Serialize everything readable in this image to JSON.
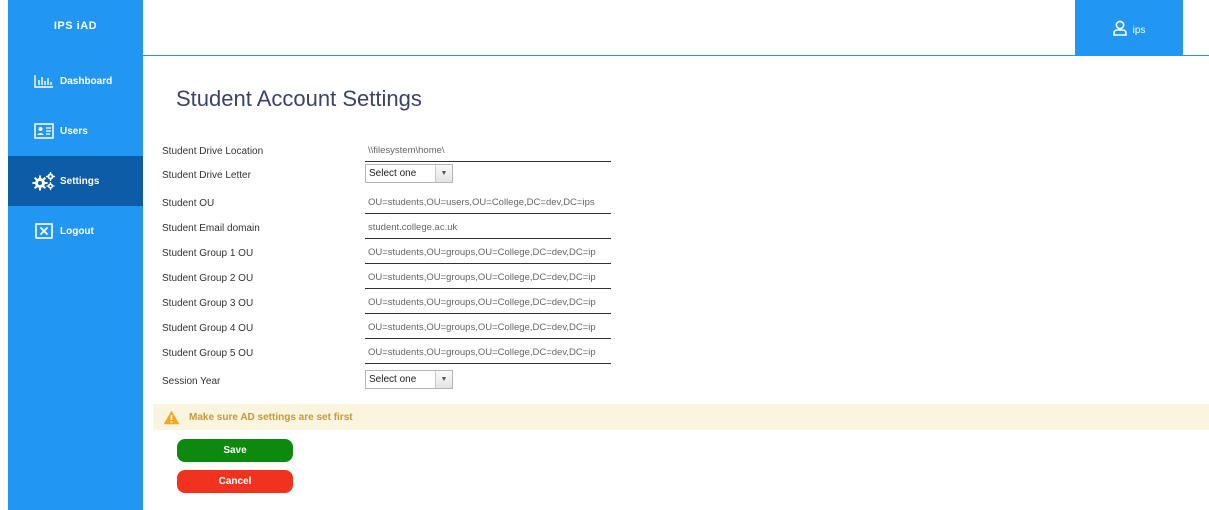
{
  "app": {
    "brand": "IPS iAD"
  },
  "sidebar": {
    "items": [
      {
        "label": "Dashboard",
        "icon": "chart-icon",
        "active": false
      },
      {
        "label": "Users",
        "icon": "id-card-icon",
        "active": false
      },
      {
        "label": "Settings",
        "icon": "gears-icon",
        "active": true
      },
      {
        "label": "Logout",
        "icon": "close-box-icon",
        "active": false
      }
    ]
  },
  "header": {
    "user": "ips",
    "user_icon": "user-icon"
  },
  "main": {
    "title": "Student Account Settings",
    "fields": {
      "drive_location": {
        "label": "Student Drive Location",
        "value": "\\\\filesystem\\home\\"
      },
      "drive_letter": {
        "label": "Student Drive Letter",
        "value": "Select one"
      },
      "ou": {
        "label": "Student OU",
        "value": "OU=students,OU=users,OU=College,DC=dev,DC=ips"
      },
      "email_domain": {
        "label": "Student Email domain",
        "value": "student.college.ac.uk"
      },
      "group1": {
        "label": "Student Group 1 OU",
        "value": "OU=students,OU=groups,OU=College,DC=dev,DC=ip"
      },
      "group2": {
        "label": "Student Group 2 OU",
        "value": "OU=students,OU=groups,OU=College,DC=dev,DC=ip"
      },
      "group3": {
        "label": "Student Group 3 OU",
        "value": "OU=students,OU=groups,OU=College,DC=dev,DC=ip"
      },
      "group4": {
        "label": "Student Group 4 OU",
        "value": "OU=students,OU=groups,OU=College,DC=dev,DC=ip"
      },
      "group5": {
        "label": "Student Group 5 OU",
        "value": "OU=students,OU=groups,OU=College,DC=dev,DC=ip"
      },
      "session_year": {
        "label": "Session Year",
        "value": "Select one"
      }
    },
    "warning": {
      "text": "Make sure AD settings are set first",
      "icon": "warning-icon"
    },
    "save_label": "Save",
    "cancel_label": "Cancel"
  },
  "colors": {
    "primary": "#2196f3",
    "active_nav": "#0d5ca8",
    "save": "#0d8a0d",
    "cancel": "#f0321e",
    "warning_bg": "#fbf4df",
    "warning_text": "#c49a3a"
  }
}
